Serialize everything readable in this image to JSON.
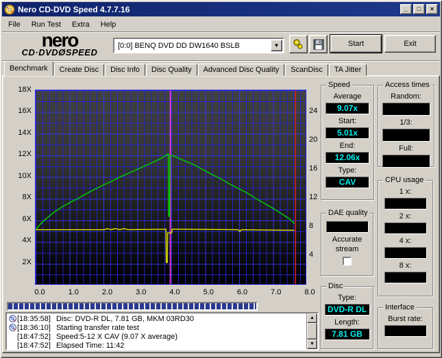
{
  "window": {
    "title": "Nero CD-DVD Speed 4.7.7.16",
    "minimize_glyph": "_",
    "maximize_glyph": "□",
    "close_glyph": "×"
  },
  "menu": {
    "items": [
      "File",
      "Run Test",
      "Extra",
      "Help"
    ]
  },
  "toolbar": {
    "logo_line1": "nero",
    "logo_line2": "CD·DVDØSPEED",
    "drive_value": "[0:0]   BENQ DVD DD DW1640 BSLB",
    "start_label": "Start",
    "exit_label": "Exit"
  },
  "tabs": {
    "active_index": 0,
    "items": [
      "Benchmark",
      "Create Disc",
      "Disc Info",
      "Disc Quality",
      "Advanced Disc Quality",
      "ScanDisc",
      "TA Jitter"
    ]
  },
  "chart_data": {
    "type": "line",
    "title": "Transfer rate benchmark (speed X vs capacity GB)",
    "xlim": [
      0,
      8
    ],
    "x_ticks": [
      "0.0",
      "1.0",
      "2.0",
      "3.0",
      "4.0",
      "5.0",
      "6.0",
      "7.0",
      "8.0"
    ],
    "left_axis": {
      "lim": [
        0,
        18
      ],
      "ticks": [
        "18X",
        "16X",
        "14X",
        "12X",
        "10X",
        "8X",
        "6X",
        "4X",
        "2X"
      ],
      "tick_values": [
        18,
        16,
        14,
        12,
        10,
        8,
        6,
        4,
        2
      ]
    },
    "right_axis": {
      "lim": [
        0,
        27
      ],
      "ticks": [
        "24",
        "20",
        "16",
        "12",
        "8",
        "4"
      ],
      "tick_values": [
        24,
        20,
        16,
        12,
        8,
        4
      ]
    },
    "grid": {
      "color": "#2222c4",
      "minor_x": 0.2,
      "minor_y": 1
    },
    "series": [
      {
        "name": "transfer-rate",
        "color": "#00d400",
        "points": [
          [
            0,
            5.01
          ],
          [
            0.12,
            5.5
          ],
          [
            0.25,
            5.9
          ],
          [
            0.4,
            6.3
          ],
          [
            0.6,
            6.8
          ],
          [
            0.8,
            7.2
          ],
          [
            1.0,
            7.55
          ],
          [
            1.25,
            7.95
          ],
          [
            1.5,
            8.4
          ],
          [
            1.75,
            8.8
          ],
          [
            2.0,
            9.2
          ],
          [
            2.25,
            9.55
          ],
          [
            2.5,
            9.95
          ],
          [
            2.75,
            10.3
          ],
          [
            3.0,
            10.65
          ],
          [
            3.25,
            11.0
          ],
          [
            3.5,
            11.35
          ],
          [
            3.7,
            11.65
          ],
          [
            3.85,
            11.95
          ],
          [
            3.93,
            12.1
          ],
          [
            3.94,
            6.3
          ],
          [
            3.97,
            6.3
          ],
          [
            3.98,
            11.95
          ],
          [
            4.1,
            11.9
          ],
          [
            4.3,
            11.6
          ],
          [
            4.5,
            11.35
          ],
          [
            4.75,
            11.0
          ],
          [
            5.0,
            10.55
          ],
          [
            5.25,
            10.15
          ],
          [
            5.5,
            9.75
          ],
          [
            5.75,
            9.3
          ],
          [
            6.0,
            8.9
          ],
          [
            6.25,
            8.5
          ],
          [
            6.5,
            8.0
          ],
          [
            6.75,
            7.55
          ],
          [
            7.0,
            7.1
          ],
          [
            7.25,
            6.6
          ],
          [
            7.5,
            6.1
          ],
          [
            7.6,
            5.85
          ],
          [
            7.67,
            5.6
          ]
        ]
      },
      {
        "name": "rotation-speed",
        "color": "#e8e800",
        "points": [
          [
            0,
            5.05
          ],
          [
            1.0,
            5.05
          ],
          [
            2.05,
            5.05
          ],
          [
            2.1,
            5.15
          ],
          [
            2.25,
            5.05
          ],
          [
            2.35,
            5.15
          ],
          [
            2.5,
            5.05
          ],
          [
            2.6,
            5.15
          ],
          [
            2.75,
            5.05
          ],
          [
            3.86,
            5.1
          ],
          [
            3.87,
            2.0
          ],
          [
            3.9,
            2.0
          ],
          [
            3.91,
            4.75
          ],
          [
            4.03,
            4.75
          ],
          [
            4.04,
            5.1
          ],
          [
            6.0,
            5.05
          ],
          [
            6.05,
            4.9
          ],
          [
            6.1,
            5.05
          ],
          [
            7.67,
            5.0
          ]
        ]
      }
    ],
    "markers": [
      {
        "name": "layer-transition-marker",
        "x": 3.99,
        "color": "#ff3cff"
      },
      {
        "name": "end-position-marker",
        "x": 7.7,
        "color": "#d42020"
      }
    ]
  },
  "panels": {
    "speed": {
      "title": "Speed",
      "fields": [
        {
          "label": "Average",
          "value": "9.07x"
        },
        {
          "label": "Start:",
          "value": "5.01x"
        },
        {
          "label": "End:",
          "value": "12.06x"
        },
        {
          "label": "Type:",
          "value": "CAV"
        }
      ]
    },
    "access": {
      "title": "Access times",
      "fields": [
        {
          "label": "Random:",
          "value": ""
        },
        {
          "label": "1/3:",
          "value": ""
        },
        {
          "label": "Full:",
          "value": ""
        }
      ]
    },
    "cpu": {
      "title": "CPU usage",
      "fields": [
        {
          "label": "1 x:",
          "value": ""
        },
        {
          "label": "2 x:",
          "value": ""
        },
        {
          "label": "4 x:",
          "value": ""
        },
        {
          "label": "8 x:",
          "value": ""
        }
      ]
    },
    "dae": {
      "title": "DAE quality",
      "value": "",
      "checkbox_label_1": "Accurate",
      "checkbox_label_2": "stream",
      "checked": false
    },
    "disc": {
      "title": "Disc",
      "fields": [
        {
          "label": "Type:",
          "value": "DVD-R DL"
        },
        {
          "label": "Length:",
          "value": "7.81 GB"
        }
      ]
    },
    "interface": {
      "title": "Interface",
      "fields": [
        {
          "label": "Burst rate:",
          "value": ""
        }
      ]
    }
  },
  "progress": {
    "percent": 100
  },
  "log": {
    "entries": [
      {
        "icon": true,
        "time": "[18:35:58]",
        "text": "Disc: DVD-R DL, 7.81 GB, MKM 03RD30"
      },
      {
        "icon": true,
        "time": "[18:36:10]",
        "text": "Starting transfer rate test"
      },
      {
        "icon": false,
        "time": "[18:47:52]",
        "text": "Speed:5-12 X CAV (9.07 X average)"
      },
      {
        "icon": false,
        "time": "[18:47:52]",
        "text": "Elapsed Time: 11:42"
      }
    ]
  },
  "colors": {
    "value_text": "#00f0f0",
    "titlebar": "#10236b",
    "progress_block": "#2b3a90"
  }
}
